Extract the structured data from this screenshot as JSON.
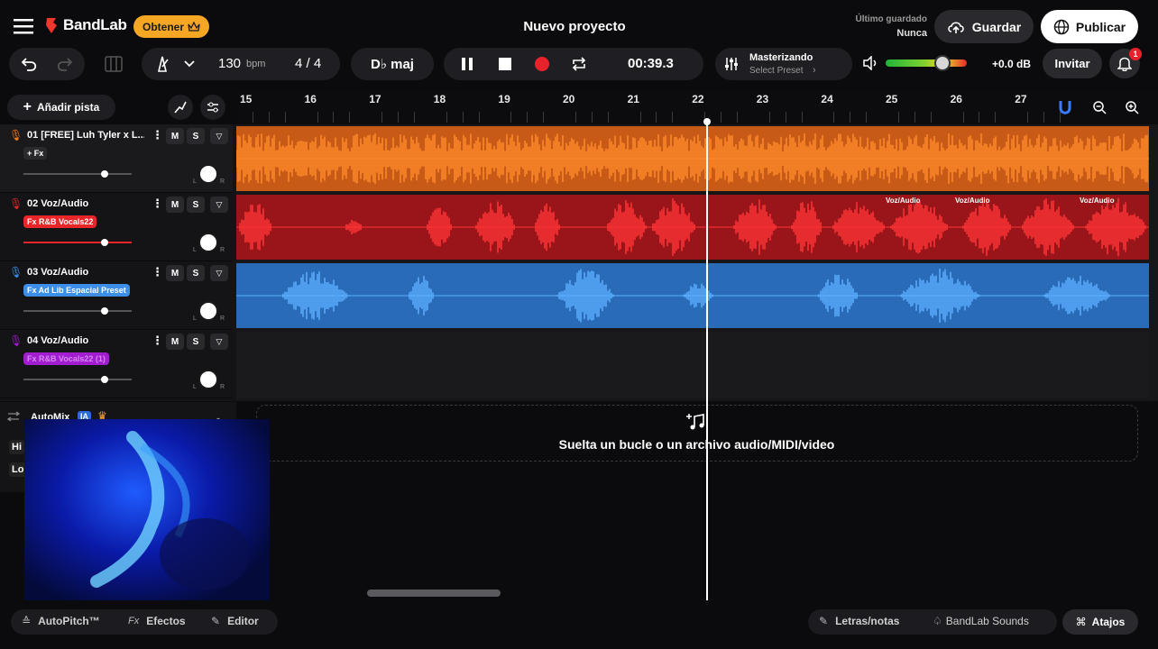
{
  "header": {
    "brand": "BandLab",
    "get_label": "Obtener",
    "project_title": "Nuevo proyecto",
    "last_saved_label": "Último guardado",
    "last_saved_value": "Nunca",
    "save_label": "Guardar",
    "publish_label": "Publicar"
  },
  "transport": {
    "bpm": "130",
    "bpm_unit": "bpm",
    "time_sig": "4 / 4",
    "key": "D♭ maj",
    "time": "00:39.3",
    "mastering_title": "Masterizando",
    "mastering_preset": "Select Preset",
    "volume_db": "+0.0 dB",
    "invite_label": "Invitar",
    "notification_count": "1",
    "volume_level": 0.7
  },
  "tracks_header": {
    "add_track": "Añadir pista"
  },
  "ruler": {
    "bars": [
      "15",
      "16",
      "17",
      "18",
      "19",
      "20",
      "21",
      "22",
      "23",
      "24",
      "25",
      "26",
      "27"
    ]
  },
  "tracks": [
    {
      "name": "01  [FREE] Luh Tyler x L...",
      "fx": "+ Fx",
      "color": "#ff7a1a",
      "volume": 0.75
    },
    {
      "name": "02  Voz/Audio",
      "fx": "Fx R&B Vocals22",
      "color": "#e8262a",
      "volume": 0.75
    },
    {
      "name": "03  Voz/Audio",
      "fx": "Fx Ad Lib Espacial Preset",
      "color": "#3b8fe8",
      "volume": 0.75
    },
    {
      "name": "04  Voz/Audio",
      "fx": "Fx R&B Vocals22 (1)",
      "color": "#a21cd0",
      "volume": 0.75
    }
  ],
  "track_buttons": {
    "mute": "M",
    "solo": "S",
    "left": "L",
    "right": "R"
  },
  "clip_labels": [
    "Voz/Audio",
    "Voz/Audio",
    "Voz/Audio"
  ],
  "automix": {
    "label": "AutoMix",
    "badge": "IA",
    "row1": "Hi",
    "row2": "Lo"
  },
  "dropzone": {
    "text": "Suelta un bucle o un archivo audio/MIDI/video"
  },
  "bottom": {
    "autopitch": "AutoPitch™",
    "effects": "Efectos",
    "editor": "Editor",
    "lyrics": "Letras/notas",
    "sounds": "BandLab Sounds",
    "shortcuts": "Atajos"
  },
  "colors": {
    "accent_orange": "#f5a623",
    "brand_red": "#f0362d",
    "track1": "#ff7a1a",
    "track2": "#e8262a",
    "track3": "#3b8fe8",
    "track4": "#a21cd0"
  }
}
